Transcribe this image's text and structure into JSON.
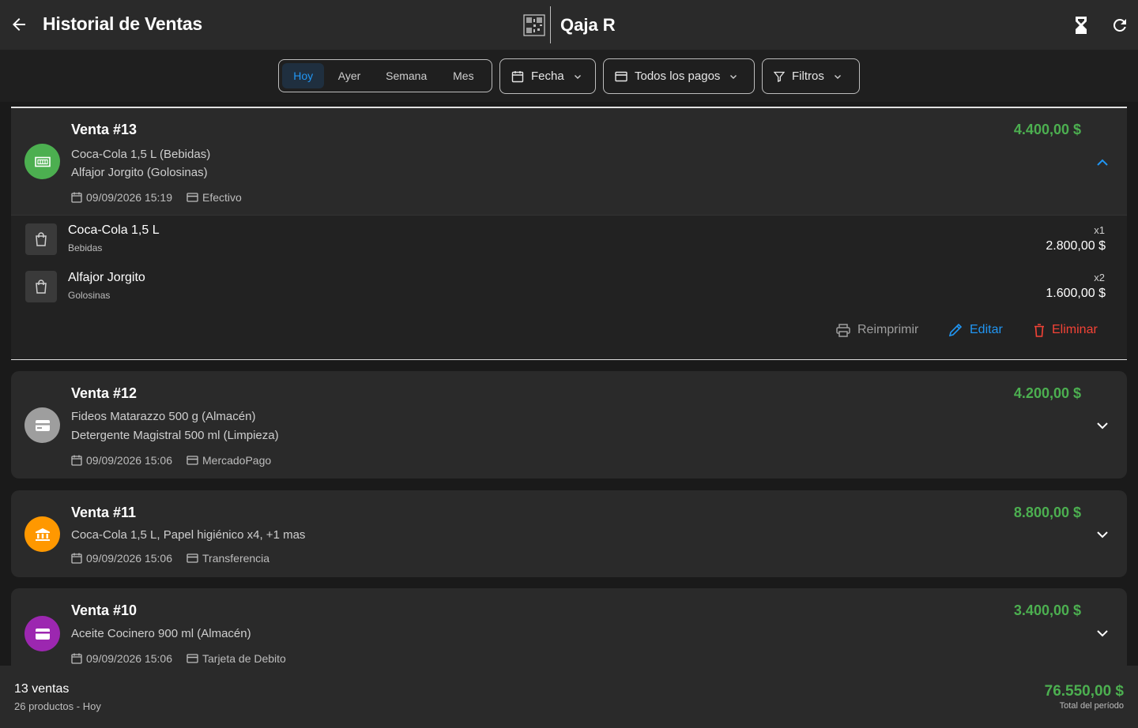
{
  "header": {
    "title": "Historial de Ventas",
    "brand_name": "Qaja R"
  },
  "filters": {
    "periods": [
      {
        "label": "Hoy",
        "active": true
      },
      {
        "label": "Ayer",
        "active": false
      },
      {
        "label": "Semana",
        "active": false
      },
      {
        "label": "Mes",
        "active": false
      }
    ],
    "date_label": "Fecha",
    "payments_label": "Todos los pagos",
    "filters_label": "Filtros"
  },
  "sales": [
    {
      "title": "Venta #13",
      "lines": [
        "Coca-Cola 1,5 L (Bebidas)",
        "Alfajor Jorgito (Golosinas)"
      ],
      "datetime": "09/09/2026 15:19",
      "payment": "Efectivo",
      "total": "4.400,00 $",
      "avatar_color": "#4caf50",
      "avatar_icon": "cash-icon",
      "expanded": true,
      "items": [
        {
          "name": "Coca-Cola 1,5 L",
          "category": "Bebidas",
          "qty": "x1",
          "price": "2.800,00 $"
        },
        {
          "name": "Alfajor Jorgito",
          "category": "Golosinas",
          "qty": "x2",
          "price": "1.600,00 $"
        }
      ],
      "actions": {
        "reprint": "Reimprimir",
        "edit": "Editar",
        "delete": "Eliminar"
      }
    },
    {
      "title": "Venta #12",
      "lines": [
        "Fideos Matarazzo 500 g (Almacén)",
        "Detergente Magistral 500 ml (Limpieza)"
      ],
      "datetime": "09/09/2026 15:06",
      "payment": "MercadoPago",
      "total": "4.200,00 $",
      "avatar_color": "#9e9e9e",
      "avatar_icon": "card-icon",
      "expanded": false
    },
    {
      "title": "Venta #11",
      "lines": [
        "Coca-Cola 1,5 L, Papel higiénico x4, +1 mas"
      ],
      "datetime": "09/09/2026 15:06",
      "payment": "Transferencia",
      "total": "8.800,00 $",
      "avatar_color": "#ff9800",
      "avatar_icon": "bank-icon",
      "expanded": false
    },
    {
      "title": "Venta #10",
      "lines": [
        "Aceite Cocinero 900 ml (Almacén)"
      ],
      "datetime": "09/09/2026 15:06",
      "payment": "Tarjeta de Debito",
      "total": "3.400,00 $",
      "avatar_color": "#9c27b0",
      "avatar_icon": "credit-card-icon",
      "expanded": false
    }
  ],
  "summary": {
    "count": "13 ventas",
    "sub": "26 productos - Hoy",
    "total": "76.550,00 $",
    "total_label": "Total del período"
  },
  "colors": {
    "accent": "#2196f3",
    "money": "#4caf50",
    "danger": "#f44336",
    "muted_action": "#9e9e9e"
  }
}
